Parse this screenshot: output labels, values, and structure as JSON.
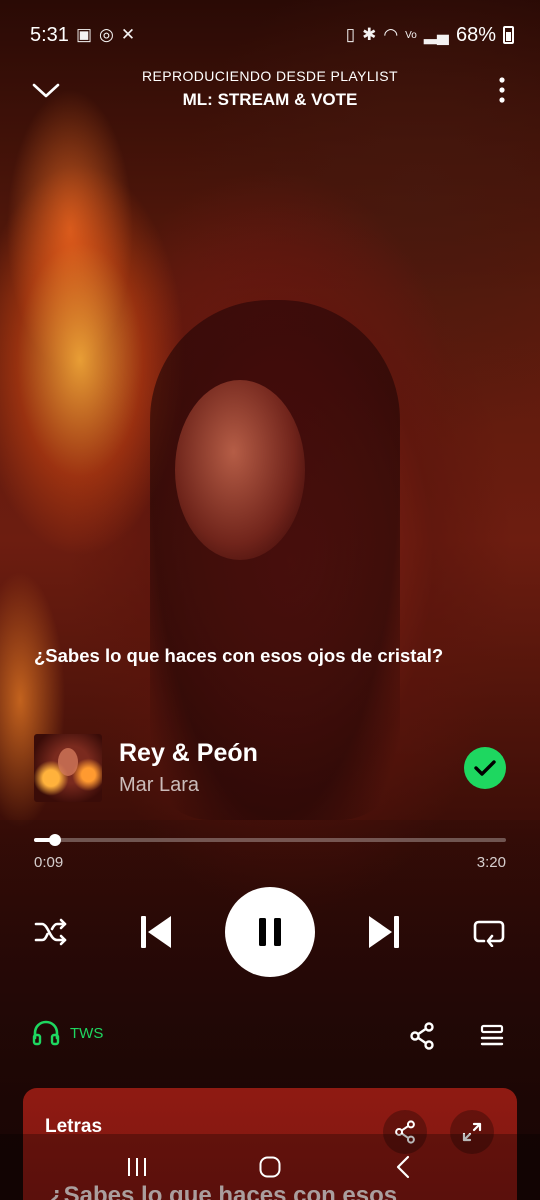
{
  "status_bar": {
    "time": "5:31",
    "left_icons": [
      "gallery-icon",
      "whatsapp-icon",
      "x-icon"
    ],
    "right_icons": [
      "data-saver-icon",
      "bluetooth-icon",
      "wifi-icon",
      "volte-icon",
      "signal-icon"
    ],
    "battery": "68%"
  },
  "header": {
    "context_label": "REPRODUCIENDO DESDE PLAYLIST",
    "playlist_name": "ML: STREAM & VOTE"
  },
  "lyric_preview": "¿Sabes lo que haces con esos ojos de cristal?",
  "track": {
    "title": "Rey & Peón",
    "artist": "Mar Lara",
    "saved": true
  },
  "playback": {
    "elapsed": "0:09",
    "duration": "3:20",
    "progress": 0.045,
    "state": "playing"
  },
  "device": {
    "name": "TWS"
  },
  "lyrics_card": {
    "title": "Letras",
    "first_line": "¿Sabes lo que haces con esos"
  },
  "colors": {
    "accent_green": "#1ed760",
    "lyrics_card_bg": "#8f1a12"
  }
}
